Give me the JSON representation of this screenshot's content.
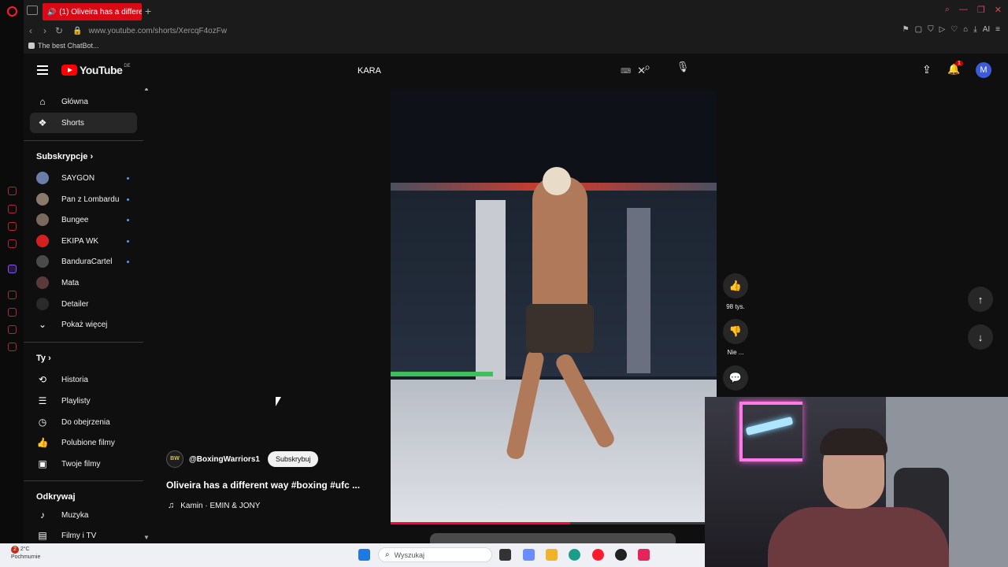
{
  "browser": {
    "tab_title": "(1) Oliveira has a differe",
    "url": "www.youtube.com/shorts/XercqF4ozFw",
    "bookmark_label": "The best ChatBot...",
    "ai_label": "AI"
  },
  "header": {
    "logo_text": "YouTube",
    "region": "DE",
    "search_value": "KARA",
    "notification_count": "1",
    "avatar_letter": "M"
  },
  "sidebar": {
    "main_items": [
      {
        "label": "Główna",
        "icon": "home-icon"
      },
      {
        "label": "Shorts",
        "icon": "shorts-icon",
        "active": true
      }
    ],
    "subscriptions_heading": "Subskrypcje",
    "subscriptions": [
      {
        "label": "SAYGON"
      },
      {
        "label": "Pan z Lombardu"
      },
      {
        "label": "Bungee"
      },
      {
        "label": "EKIPA WK"
      },
      {
        "label": "BanduraCartel"
      },
      {
        "label": "Mata"
      },
      {
        "label": "Detailer"
      }
    ],
    "show_more_label": "Pokaż więcej",
    "you_heading": "Ty",
    "you_items": [
      {
        "label": "Historia",
        "icon": "history-icon"
      },
      {
        "label": "Playlisty",
        "icon": "playlist-icon"
      },
      {
        "label": "Do obejrzenia",
        "icon": "watch-later-icon"
      },
      {
        "label": "Polubione filmy",
        "icon": "liked-icon"
      },
      {
        "label": "Twoje filmy",
        "icon": "your-videos-icon"
      }
    ],
    "explore_heading": "Odkrywaj",
    "explore_items": [
      {
        "label": "Muzyka",
        "icon": "music-icon"
      },
      {
        "label": "Filmy i TV",
        "icon": "movies-icon"
      }
    ]
  },
  "short": {
    "channel_avatar_text": "BW",
    "channel_name": "@BoxingWarriors1",
    "subscribe_label": "Subskrybuj",
    "title": "Oliveira has a different way #boxing  #ufc ...",
    "music": "Kamin · EMIN & JONY",
    "progress": 0.55,
    "like_count": "98 tys.",
    "dislike_label": "Nie ..."
  },
  "taskbar": {
    "weather_temp": "2°C",
    "weather_desc": "Pochmurnie",
    "weather_badge": "2",
    "search_placeholder": "Wyszukaj"
  },
  "colors": {
    "accent": "#ff0000",
    "opera": "#ff1b2d",
    "tab_active": "#d90a16"
  }
}
